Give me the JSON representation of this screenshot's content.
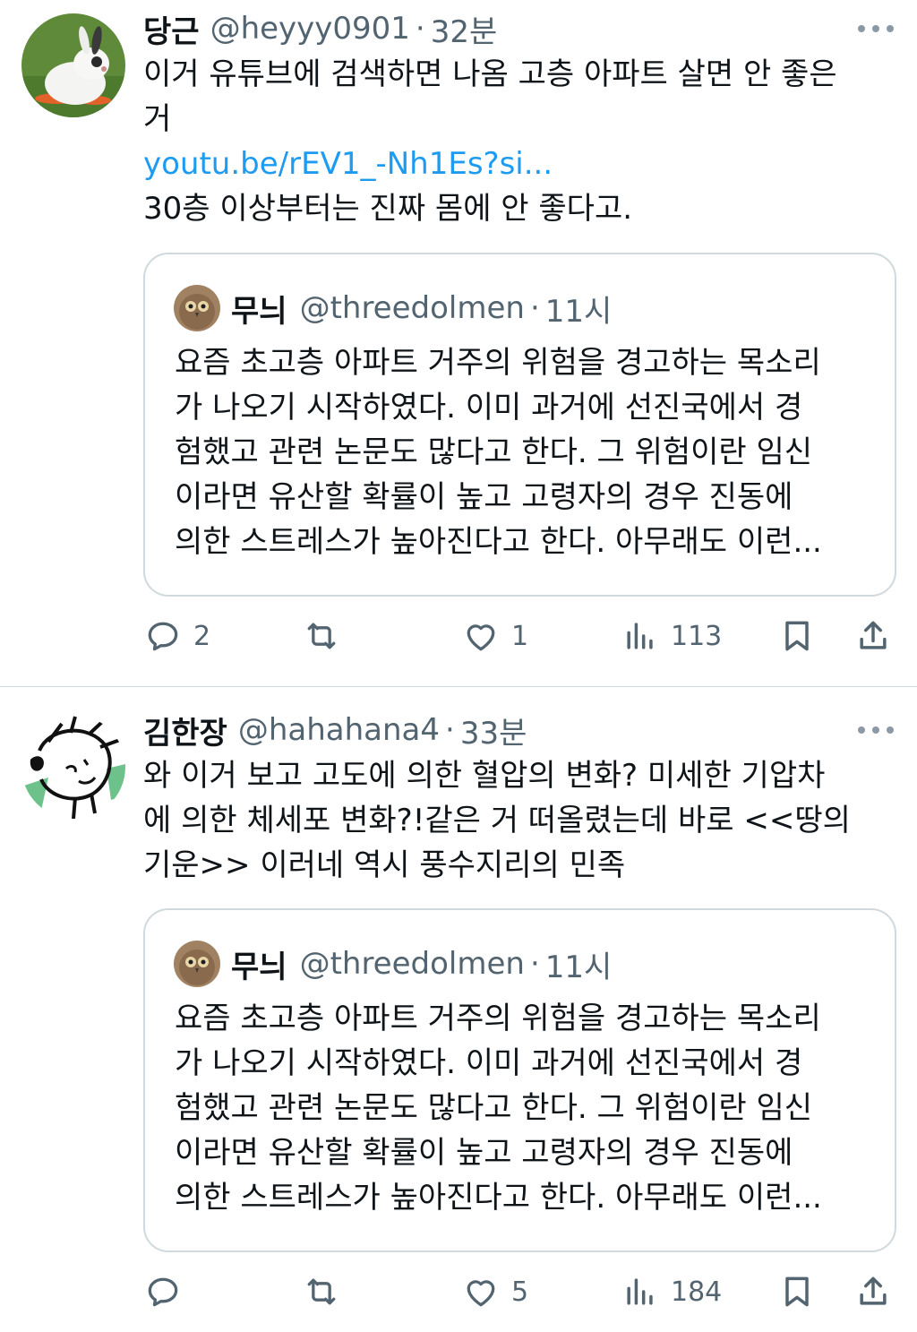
{
  "tweets": [
    {
      "name": "당근",
      "handle": "@heyyy0901",
      "separator": "·",
      "time": "32분",
      "avatar_icon": "rabbit-avatar",
      "text_lines": [
        "이거 유튜브에 검색하면 나옴 고층 아파트 살면 안 좋은",
        "거"
      ],
      "link": "youtu.be/rEV1_-Nh1Es?si...",
      "text_after": "30층 이상부터는 진짜 몸에 안 좋다고.",
      "quote": {
        "name": "무늬",
        "handle": "@threedolmen",
        "separator": "·",
        "time": "11시",
        "avatar_icon": "owl-avatar",
        "text_lines": [
          "요즘 초고층 아파트 거주의 위험을 경고하는 목소리",
          "가 나오기 시작하였다. 이미 과거에 선진국에서 경",
          "험했고 관련 논문도 많다고 한다. 그 위험이란 임신",
          "이라면 유산할 확률이 높고 고령자의 경우 진동에",
          "의한 스트레스가 높아진다고 한다. 아무래도 이런..."
        ]
      },
      "actions": {
        "replies": "2",
        "retweets": "",
        "likes": "1",
        "views": "113"
      }
    },
    {
      "name": "김한장",
      "handle": "@hahahana4",
      "separator": "·",
      "time": "33분",
      "avatar_icon": "doodle-avatar",
      "text_lines": [
        "와 이거 보고 고도에 의한 혈압의 변화? 미세한 기압차",
        "에 의한 체세포 변화?!같은 거 떠올렸는데 바로 <<땅의",
        "기운>> 이러네 역시 풍수지리의 민족"
      ],
      "quote": {
        "name": "무늬",
        "handle": "@threedolmen",
        "separator": "·",
        "time": "11시",
        "avatar_icon": "owl-avatar",
        "text_lines": [
          "요즘 초고층 아파트 거주의 위험을 경고하는 목소리",
          "가 나오기 시작하였다. 이미 과거에 선진국에서 경",
          "험했고 관련 논문도 많다고 한다. 그 위험이란 임신",
          "이라면 유산할 확률이 높고 고령자의 경우 진동에",
          "의한 스트레스가 높아진다고 한다. 아무래도 이런..."
        ]
      },
      "actions": {
        "replies": "",
        "retweets": "",
        "likes": "5",
        "views": "184"
      }
    }
  ],
  "colors": {
    "text": "#0f1419",
    "secondary": "#536471",
    "link": "#1d9bf0",
    "border": "#cfd9de"
  }
}
